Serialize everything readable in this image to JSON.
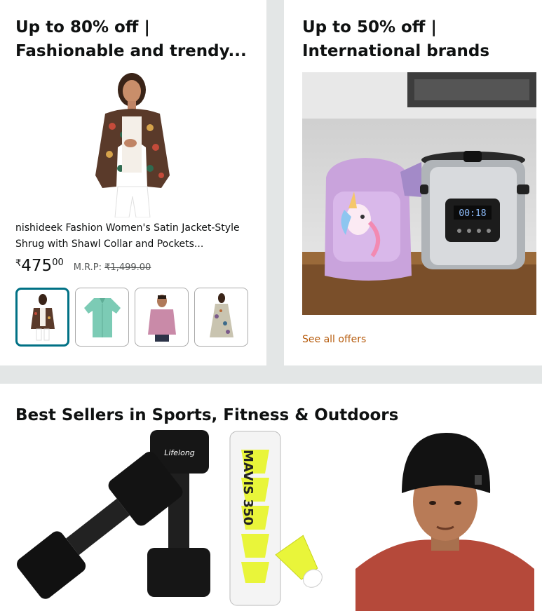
{
  "card1": {
    "title": "Up to 80% off | Fashionable and trendy...",
    "product_name": "nishideek Fashion Women's Satin Jacket-Style Shrug with Shawl Collar and Pockets...",
    "price_symbol": "₹",
    "price_whole": "475",
    "price_fraction": "00",
    "mrp_label": "M.R.P:",
    "mrp_value": "₹1,499.00",
    "thumbnails": [
      "jacket-thumb",
      "teal-shirt-thumb",
      "pink-shirt-thumb",
      "printed-dress-thumb"
    ]
  },
  "card2": {
    "title": "Up to 50% off | International brands",
    "banner_display": "00:18",
    "see_all": "See all offers"
  },
  "card3": {
    "title": "Best Sellers in Sports, Fitness & Outdoors",
    "dumbbell_brand": "Lifelong",
    "shuttle_brand": "MAVIS 350"
  },
  "colors": {
    "link": "#b65b0c",
    "selected_border": "#007185",
    "page_bg": "#e3e6e6"
  }
}
